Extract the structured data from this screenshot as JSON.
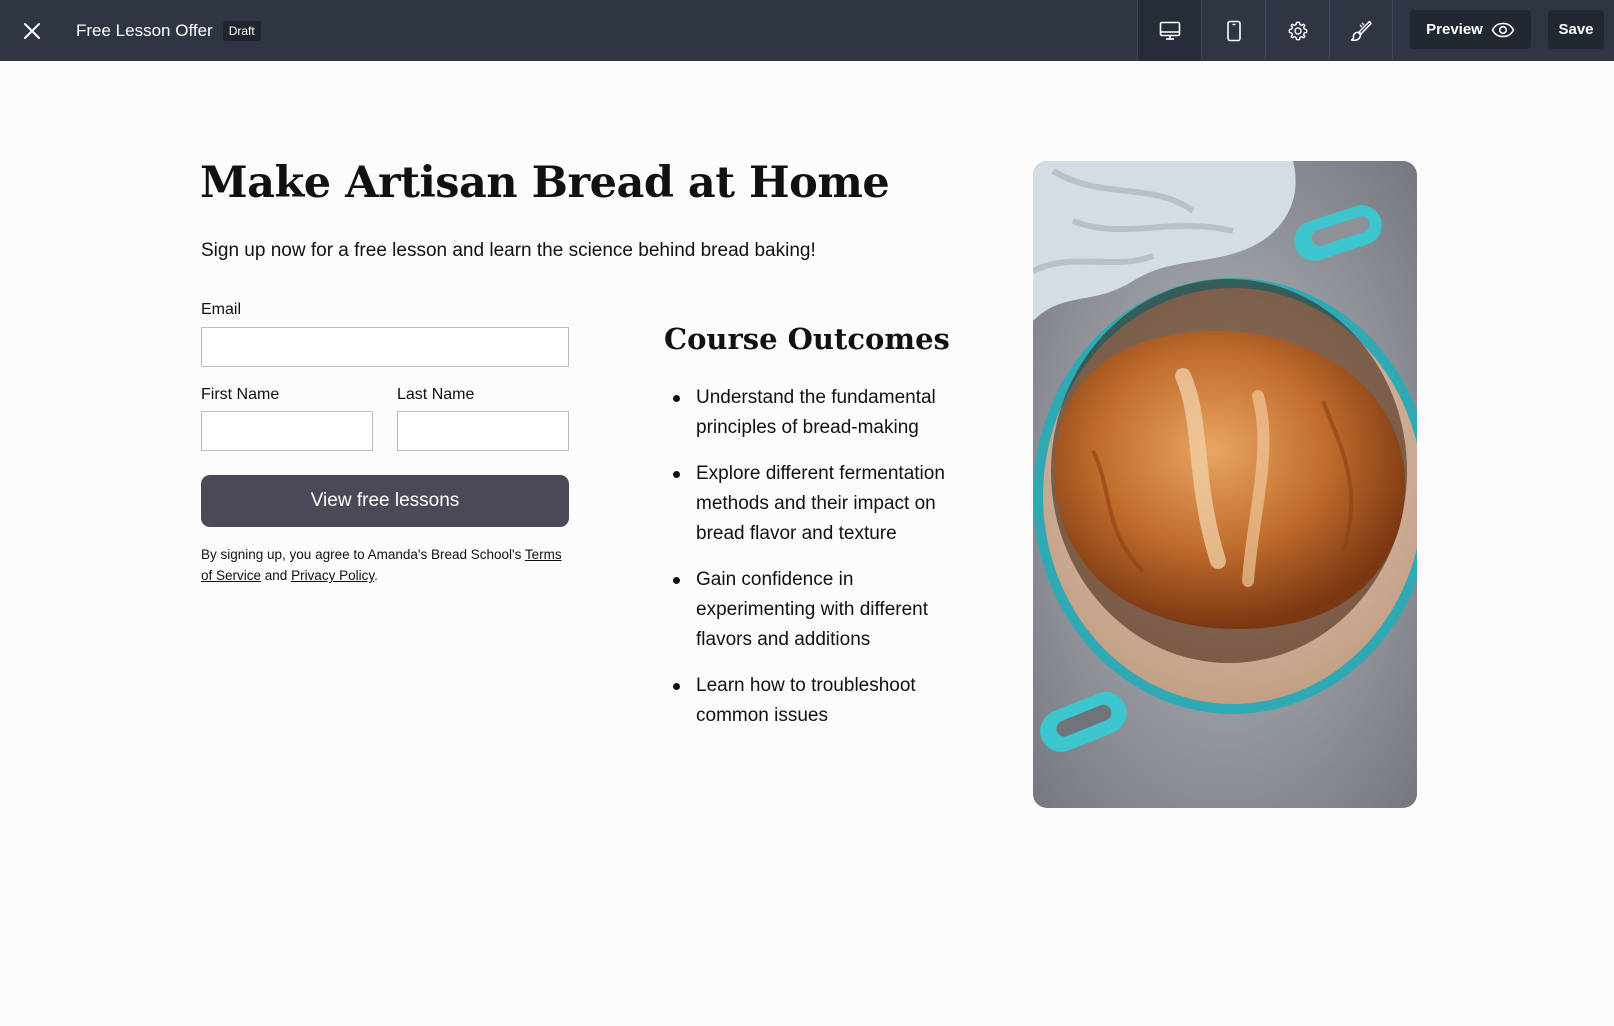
{
  "header": {
    "page_title": "Free Lesson Offer",
    "status_badge": "Draft",
    "preview_label": "Preview",
    "save_label": "Save",
    "tools": [
      "desktop-icon",
      "mobile-icon",
      "gear-icon",
      "paintbrush-icon"
    ]
  },
  "hero": {
    "title": "Make Artisan Bread at Home",
    "subtitle": "Sign up now for a free lesson and learn the science behind bread baking!"
  },
  "form": {
    "email_label": "Email",
    "first_name_label": "First Name",
    "last_name_label": "Last Name",
    "email_value": "",
    "first_name_value": "",
    "last_name_value": "",
    "submit_label": "View free lessons",
    "legal_prefix": "By signing up, you agree to Amanda's Bread School's ",
    "terms_link": "Terms of Service",
    "legal_and": " and ",
    "privacy_link": "Privacy Policy",
    "legal_suffix": "."
  },
  "outcomes": {
    "title": "Course Outcomes",
    "items": [
      "Understand the fundamental principles of bread-making",
      "Explore different fermentation methods and their impact on bread flavor and texture",
      "Gain confidence in experimenting with different flavors and additions",
      "Learn how to troubleshoot common issues"
    ]
  },
  "colors": {
    "topbar": "#2f3542",
    "button": "#4a4957",
    "pot_teal": "#3ec6cf",
    "bread": "#b9642a"
  }
}
